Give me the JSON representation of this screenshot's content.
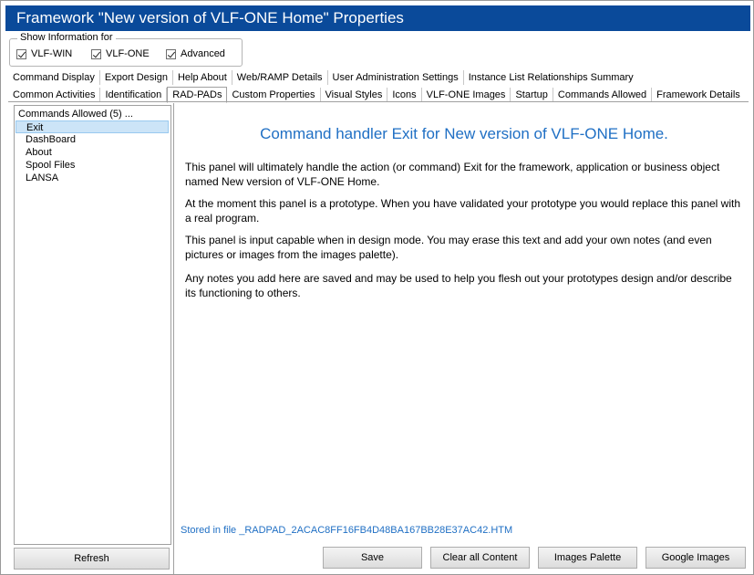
{
  "window": {
    "title": "Framework \"New version of VLF-ONE Home\" Properties"
  },
  "show_information": {
    "legend": "Show Information for",
    "options": [
      {
        "label": "VLF-WIN",
        "checked": true
      },
      {
        "label": "VLF-ONE",
        "checked": true
      },
      {
        "label": "Advanced",
        "checked": true
      }
    ]
  },
  "tabs": {
    "row1": [
      "Command Display",
      "Export Design",
      "Help About",
      "Web/RAMP Details",
      "User Administration Settings",
      "Instance List Relationships Summary"
    ],
    "row2": [
      "Common Activities",
      "Identification",
      "RAD-PADs",
      "Custom Properties",
      "Visual Styles",
      "Icons",
      "VLF-ONE Images",
      "Startup",
      "Commands Allowed",
      "Framework Details"
    ],
    "active": "RAD-PADs"
  },
  "commands_tree": {
    "root": "Commands Allowed (5) ...",
    "items": [
      "Exit",
      "DashBoard",
      "About",
      "Spool Files",
      "LANSA"
    ],
    "selected": "Exit"
  },
  "buttons": {
    "refresh": "Refresh",
    "save": "Save",
    "clear": "Clear all Content",
    "images_palette": "Images Palette",
    "google_images": "Google Images"
  },
  "content": {
    "title": "Command handler Exit for New version of VLF-ONE Home.",
    "paragraphs": [
      "This panel will ultimately handle the action (or command) Exit for the framework, application or business object named New version of VLF-ONE Home.",
      "At the moment this panel is a prototype. When you have validated your prototype you would replace this panel with a real program.",
      "This panel is input capable when in design mode. You may erase this text and add your own notes (and even pictures or images from the images palette).",
      "Any notes you add here are saved and may be used to help you flesh out your prototypes design and/or describe its functioning to others."
    ],
    "stored_in": "Stored in file _RADPAD_2ACAC8FF16FB4D48BA167BB28E37AC42.HTM"
  },
  "colors": {
    "titlebar": "#0a4a9a",
    "accent_text": "#1f6fc4",
    "selection": "#cce4f7"
  }
}
